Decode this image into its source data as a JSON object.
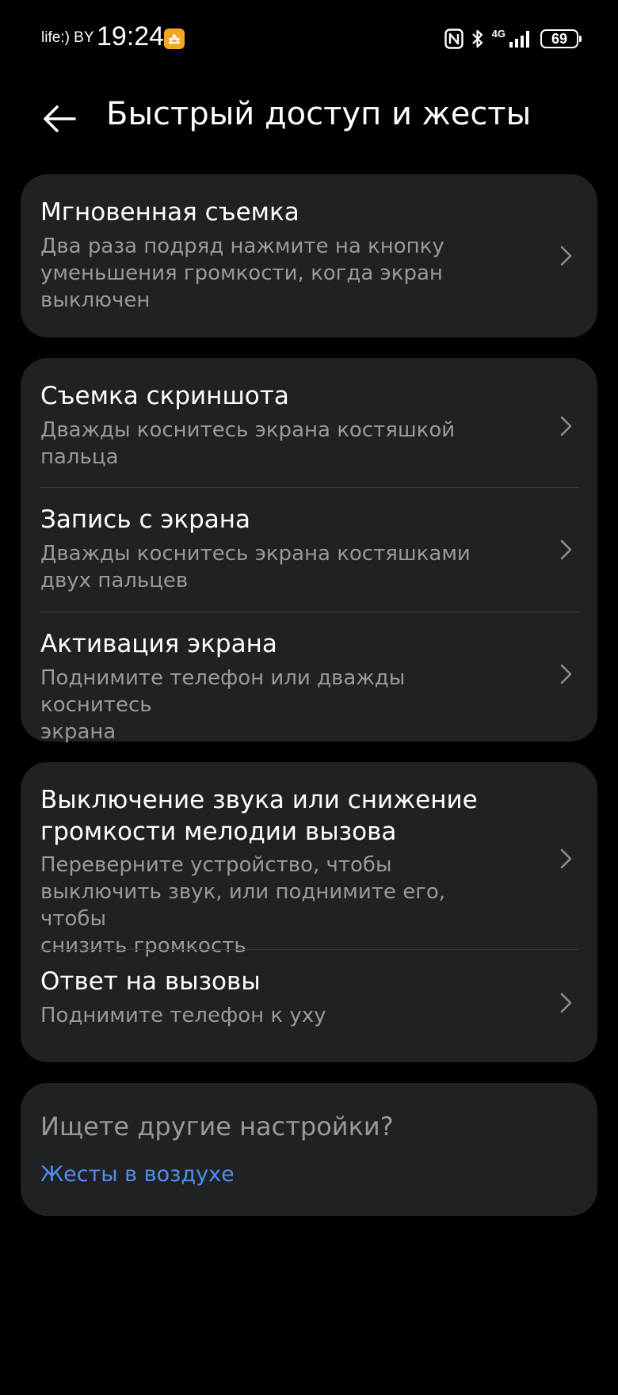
{
  "status_bar": {
    "carrier": "life:) BY",
    "time": "19:24",
    "network_type": "4G",
    "battery_level": "69",
    "app_notification_icon": "app-notification-icon",
    "accent_color": "#f5a623"
  },
  "header": {
    "back_icon": "arrow-left-icon",
    "title": "Быстрый доступ и жесты"
  },
  "groups": [
    {
      "items": [
        {
          "title": "Мгновенная съемка",
          "subtitle_lines": [
            "Два раза подряд нажмите на кнопку",
            "уменьшения громкости, когда экран",
            "выключен"
          ]
        }
      ]
    },
    {
      "items": [
        {
          "title": "Съемка скриншота",
          "subtitle_lines": [
            "Дважды коснитесь экрана костяшкой",
            "пальца"
          ]
        },
        {
          "title": "Запись с экрана",
          "subtitle_lines": [
            "Дважды коснитесь экрана костяшками",
            "двух пальцев"
          ]
        },
        {
          "title": "Активация экрана",
          "subtitle_lines": [
            "Поднимите телефон или дважды коснитесь",
            "экрана"
          ]
        }
      ]
    },
    {
      "items": [
        {
          "title_lines": [
            "Выключение звука или снижение",
            "громкости мелодии вызова"
          ],
          "subtitle_lines": [
            "Переверните устройство, чтобы",
            "выключить звук, или поднимите его, чтобы",
            "снизить громкость"
          ]
        },
        {
          "title": "Ответ на вызовы",
          "subtitle_lines": [
            "Поднимите телефон к уху"
          ]
        }
      ]
    }
  ],
  "footer": {
    "hint": "Ищете другие настройки?",
    "link": "Жесты в воздухе",
    "link_color": "#4d8ef4"
  },
  "colors": {
    "background": "#000000",
    "card": "#202123",
    "secondary_text": "#97999c"
  }
}
